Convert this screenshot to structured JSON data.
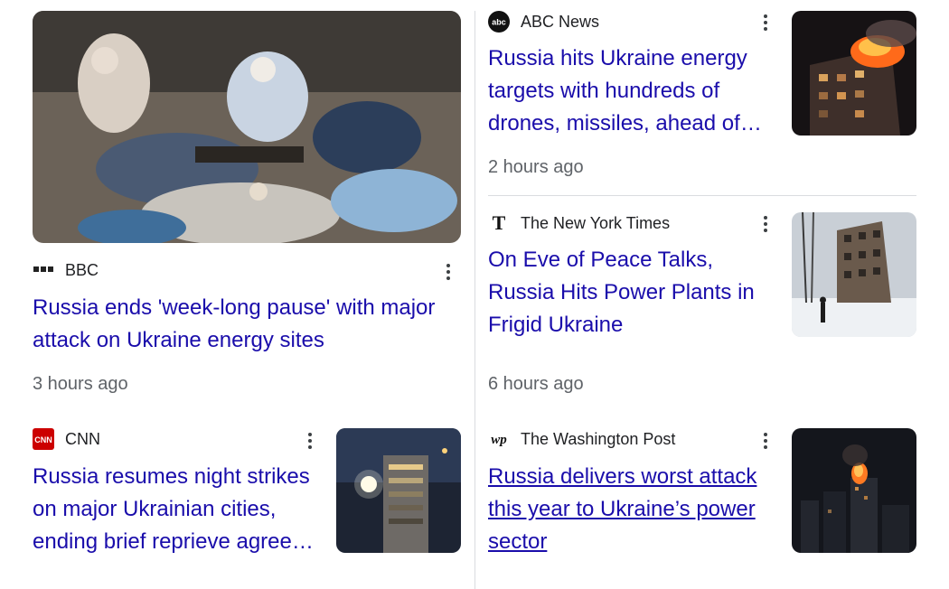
{
  "articles": [
    {
      "source": "BBC",
      "source_logo": "bbc-logo",
      "headline": "Russia ends 'week-long pause' with major attack on Ukraine energy sites",
      "time": "3 hours ago",
      "image": "people-sheltering-under-blankets-photo"
    },
    {
      "source": "CNN",
      "source_logo": "cnn-logo",
      "headline": "Russia resumes night strikes on major Ukrainian cities, ending brief reprieve agreed with Trump",
      "time": "",
      "image": "night-apartment-tower-photo"
    },
    {
      "source": "ABC News",
      "source_logo": "abc-logo",
      "headline": "Russia hits Ukraine energy targets with hundreds of drones, missiles, ahead of talks",
      "time": "2 hours ago",
      "image": "burning-apartment-building-photo"
    },
    {
      "source": "The New York Times",
      "source_logo": "nyt-logo",
      "headline": "On Eve of Peace Talks, Russia Hits Power Plants in Frigid Ukraine",
      "time": "6 hours ago",
      "image": "damaged-building-snow-photo"
    },
    {
      "source": "The Washington Post",
      "source_logo": "wapo-logo",
      "headline": "Russia delivers worst attack this year to Ukraine’s power sector",
      "time": "",
      "image": "city-fire-night-photo"
    }
  ],
  "logos": {
    "bbc": "▪▪▪",
    "cnn": "CNN",
    "abc": "abc",
    "nyt": "T",
    "wapo": "wp"
  },
  "colors": {
    "headline": "#1a0dab",
    "meta": "#5f6368",
    "cnn_red": "#cc0000"
  }
}
